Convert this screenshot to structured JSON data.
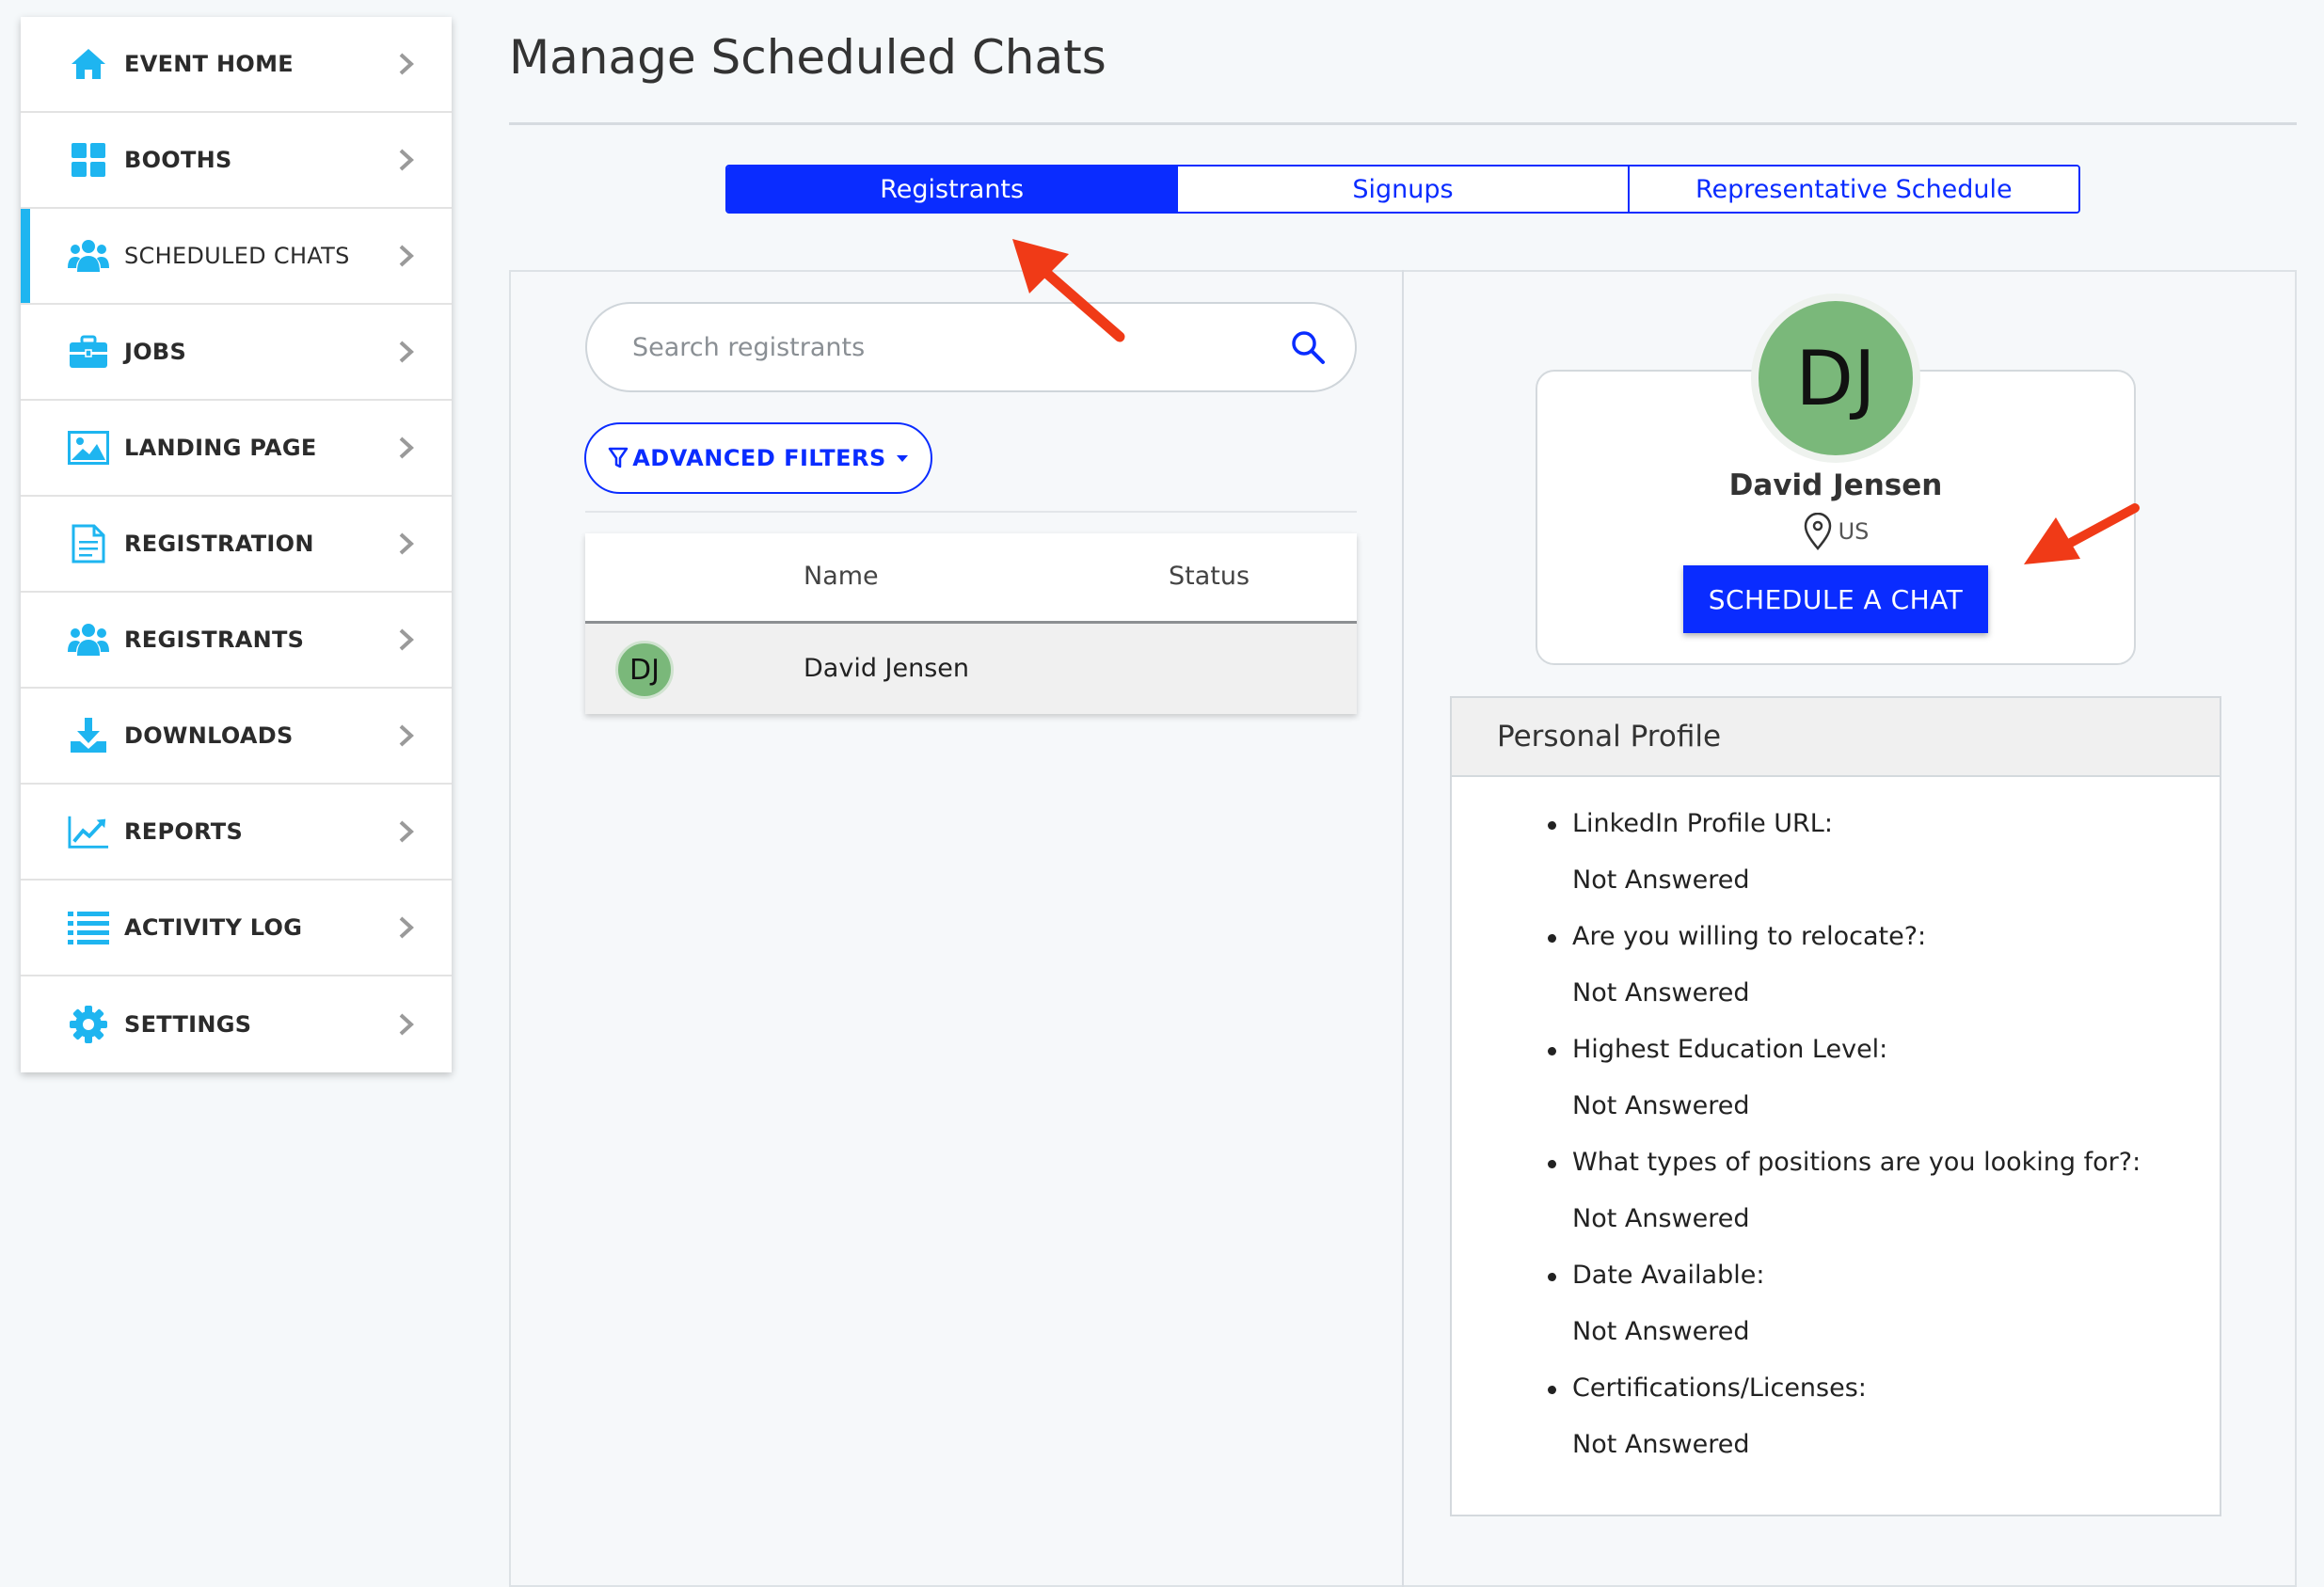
{
  "sidebar": {
    "items": [
      {
        "label": "EVENT HOME",
        "icon": "home-icon"
      },
      {
        "label": "BOOTHS",
        "icon": "grid-icon"
      },
      {
        "label": "SCHEDULED CHATS",
        "icon": "users-icon",
        "active": true
      },
      {
        "label": "JOBS",
        "icon": "briefcase-icon"
      },
      {
        "label": "LANDING PAGE",
        "icon": "image-icon"
      },
      {
        "label": "REGISTRATION",
        "icon": "document-icon"
      },
      {
        "label": "REGISTRANTS",
        "icon": "users-icon"
      },
      {
        "label": "DOWNLOADS",
        "icon": "download-icon"
      },
      {
        "label": "REPORTS",
        "icon": "chart-line-icon"
      },
      {
        "label": "ACTIVITY LOG",
        "icon": "list-icon"
      },
      {
        "label": "SETTINGS",
        "icon": "gear-icon"
      }
    ]
  },
  "page": {
    "title": "Manage Scheduled Chats"
  },
  "tabs": [
    {
      "label": "Registrants",
      "active": true
    },
    {
      "label": "Signups"
    },
    {
      "label": "Representative Schedule"
    }
  ],
  "search": {
    "placeholder": "Search registrants",
    "value": ""
  },
  "filters": {
    "label": "ADVANCED FILTERS"
  },
  "table": {
    "columns": [
      "Name",
      "Status"
    ],
    "rows": [
      {
        "initials": "DJ",
        "name": "David Jensen",
        "status": ""
      }
    ]
  },
  "profile": {
    "initials": "DJ",
    "name": "David Jensen",
    "location": "US",
    "schedule_button": "SCHEDULE A CHAT"
  },
  "personal_profile": {
    "heading": "Personal Profile",
    "items": [
      {
        "question": "LinkedIn Profile URL:",
        "answer": "Not Answered"
      },
      {
        "question": "Are you willing to relocate?:",
        "answer": "Not Answered"
      },
      {
        "question": "Highest Education Level:",
        "answer": "Not Answered"
      },
      {
        "question": "What types of positions are you looking for?:",
        "answer": "Not Answered"
      },
      {
        "question": "Date Available:",
        "answer": "Not Answered"
      },
      {
        "question": "Certifications/Licenses:",
        "answer": "Not Answered"
      }
    ]
  },
  "colors": {
    "accent_blue": "#0a2cff",
    "sidebar_icon": "#1eb5f0",
    "avatar_green": "#7ab87a",
    "annotation_red": "#f03a17"
  }
}
